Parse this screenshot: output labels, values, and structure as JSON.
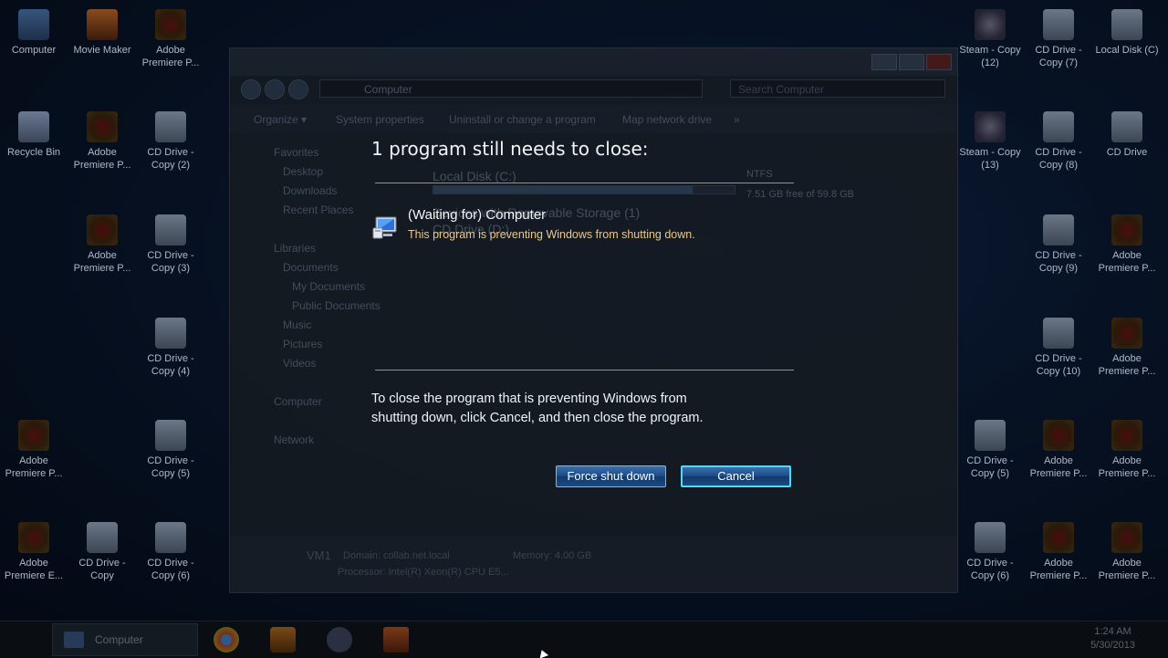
{
  "desktop": {
    "icons": [
      {
        "label": "Computer",
        "kind": "comp"
      },
      {
        "label": "Movie Maker",
        "kind": "app"
      },
      {
        "label": "Adobe Premiere P...",
        "kind": "prem"
      },
      {
        "label": "Steam - Copy (12)",
        "kind": "steam"
      },
      {
        "label": "CD Drive - Copy (7)",
        "kind": "cd"
      },
      {
        "label": "Local Disk (C)",
        "kind": "cd"
      },
      {
        "label": "Recycle Bin",
        "kind": "bin"
      },
      {
        "label": "Adobe Premiere P...",
        "kind": "prem"
      },
      {
        "label": "CD Drive - Copy (2)",
        "kind": "cd"
      },
      {
        "label": "Steam - Copy (13)",
        "kind": "steam"
      },
      {
        "label": "CD Drive - Copy (8)",
        "kind": "cd"
      },
      {
        "label": "CD Drive",
        "kind": "cd"
      },
      {
        "label": "Adobe Premiere P...",
        "kind": "prem"
      },
      {
        "label": "CD Drive - Copy (3)",
        "kind": "cd"
      },
      {
        "label": "CD Drive - Copy (9)",
        "kind": "cd"
      },
      {
        "label": "Adobe Premiere P...",
        "kind": "prem"
      },
      {
        "label": "CD Drive - Copy (4)",
        "kind": "cd"
      },
      {
        "label": "CD Drive - Copy (10)",
        "kind": "cd"
      },
      {
        "label": "Adobe Premiere P...",
        "kind": "prem"
      },
      {
        "label": "Adobe Premiere P...",
        "kind": "prem"
      },
      {
        "label": "CD Drive - Copy (5)",
        "kind": "cd"
      },
      {
        "label": "CD Drive - Copy (5)",
        "kind": "cd"
      },
      {
        "label": "Adobe Premiere P...",
        "kind": "prem"
      },
      {
        "label": "Adobe Premiere P...",
        "kind": "prem"
      },
      {
        "label": "Adobe Premiere E...",
        "kind": "prem"
      },
      {
        "label": "CD Drive - Copy",
        "kind": "cd"
      },
      {
        "label": "CD Drive - Copy (6)",
        "kind": "cd"
      },
      {
        "label": "CD Drive - Copy (6)",
        "kind": "cd"
      },
      {
        "label": "Adobe Premiere P...",
        "kind": "prem"
      },
      {
        "label": "Adobe Premiere P...",
        "kind": "prem"
      }
    ]
  },
  "explorer": {
    "address": "Computer",
    "search_placeholder": "Search Computer",
    "commands": {
      "organize": "Organize ▾",
      "system_properties": "System properties",
      "uninstall": "Uninstall or change a program",
      "map_drive": "Map network drive",
      "more": "»"
    },
    "nav": {
      "favorites": "Favorites",
      "desktop": "Desktop",
      "downloads": "Downloads",
      "recent": "Recent Places",
      "libraries": "Libraries",
      "documents": "Documents",
      "my_documents": "My Documents",
      "public_documents": "Public Documents",
      "music": "Music",
      "pictures": "Pictures",
      "videos": "Videos",
      "computer": "Computer",
      "network": "Network"
    },
    "drives": {
      "local_disk": "Local Disk (C:)",
      "fs": "NTFS",
      "free": "7.51 GB free of 59.8 GB",
      "removable_header": "Devices with Removable Storage (1)",
      "cd_drive": "CD Drive (D:)"
    },
    "details": {
      "name": "VM1",
      "domain": "Domain: collab.net.local",
      "memory": "Memory: 4.00 GB",
      "processor": "Processor: Intel(R) Xeon(R) CPU E5..."
    }
  },
  "dialog": {
    "title": "1 program still needs to close:",
    "program_name": "(Waiting for) Computer",
    "program_message": "This program is preventing Windows from shutting down.",
    "body_line1": "To close the program that is preventing Windows from",
    "body_line2": "shutting down, click Cancel, and then close the program.",
    "force_button": "Force shut down",
    "cancel_button": "Cancel"
  },
  "taskbar": {
    "computer_label": "Computer",
    "time": "1:24 AM",
    "date": "5/30/2013"
  },
  "colors": {
    "warning_text": "#e9c88f",
    "button_blue": "#1d4c86",
    "focus_ring": "#5ad6f5"
  }
}
